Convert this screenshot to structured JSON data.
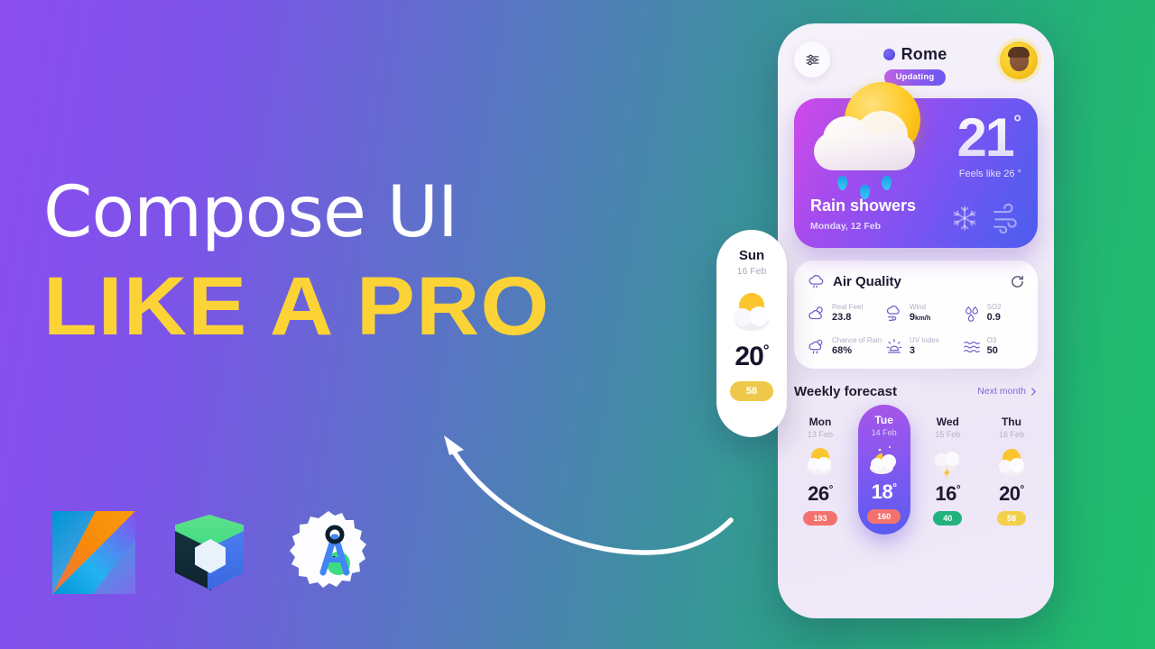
{
  "promo": {
    "line1": "Compose UI",
    "line2": "LIKE A PRO",
    "accent_color": "#FCD337",
    "bg_from": "#8B4DF0",
    "bg_to": "#22B573"
  },
  "logos": [
    {
      "name": "kotlin-logo",
      "label": "Kotlin"
    },
    {
      "name": "jetpack-compose-logo",
      "label": "Jetpack Compose"
    },
    {
      "name": "android-studio-logo",
      "label": "Android Studio"
    }
  ],
  "phone": {
    "header": {
      "tune_icon": "sliders-icon",
      "city": "Rome",
      "location_icon": "location-dot-icon",
      "status_badge": "Updating",
      "avatar": "user-avatar"
    },
    "hero": {
      "weather_icon": "sun-behind-rain-cloud-icon",
      "temperature": "21",
      "degree": "°",
      "feels_like": "Feels like 26",
      "feels_like_degree": "°",
      "condition": "Rain showers",
      "date": "Monday, 12 Feb",
      "extra_icons": [
        "snowflake-icon",
        "wind-icon"
      ]
    },
    "air_quality": {
      "icon": "cloud-rain-icon",
      "title": "Air Quality",
      "refresh_icon": "refresh-icon",
      "metrics": [
        {
          "icon": "sun-cloud-icon",
          "label": "Real Feel",
          "value": "23.8",
          "unit": ""
        },
        {
          "icon": "wind-cloud-icon",
          "label": "Wind",
          "value": "9",
          "unit": "km/h"
        },
        {
          "icon": "droplets-icon",
          "label": "SO2",
          "value": "0.9",
          "unit": ""
        },
        {
          "icon": "rain-cloud-icon",
          "label": "Chance of Rain",
          "value": "68%",
          "unit": ""
        },
        {
          "icon": "uv-sun-icon",
          "label": "UV Index",
          "value": "3",
          "unit": ""
        },
        {
          "icon": "waves-icon",
          "label": "O3",
          "value": "50",
          "unit": ""
        }
      ]
    },
    "weekly": {
      "title": "Weekly forecast",
      "next_label": "Next month",
      "next_icon": "chevron-right-icon",
      "days": [
        {
          "name": "Mon",
          "date": "13 Feb",
          "icon": "sun-cloud-icon",
          "temp": "26",
          "degree": "°",
          "badge": "193",
          "badge_color": "#F4726E",
          "selected": false
        },
        {
          "name": "Tue",
          "date": "14 Feb",
          "icon": "moon-cloud-icon",
          "temp": "18",
          "degree": "°",
          "badge": "160",
          "badge_color": "#F4726E",
          "selected": true
        },
        {
          "name": "Wed",
          "date": "15 Feb",
          "icon": "storm-cloud-icon",
          "temp": "16",
          "degree": "°",
          "badge": "40",
          "badge_color": "#22B27E",
          "selected": false
        },
        {
          "name": "Thu",
          "date": "16 Feb",
          "icon": "sun-cloud-icon",
          "temp": "20",
          "degree": "°",
          "badge": "58",
          "badge_color": "#F2D04B",
          "selected": false
        }
      ]
    }
  },
  "sun_card": {
    "name": "Sun",
    "date": "16 Feb",
    "icon": "sun-cloud-icon",
    "temp": "20",
    "degree": "°",
    "badge": "58",
    "badge_color": "#EFC84B"
  },
  "arrow": {
    "name": "curved-arrow-annotation"
  }
}
